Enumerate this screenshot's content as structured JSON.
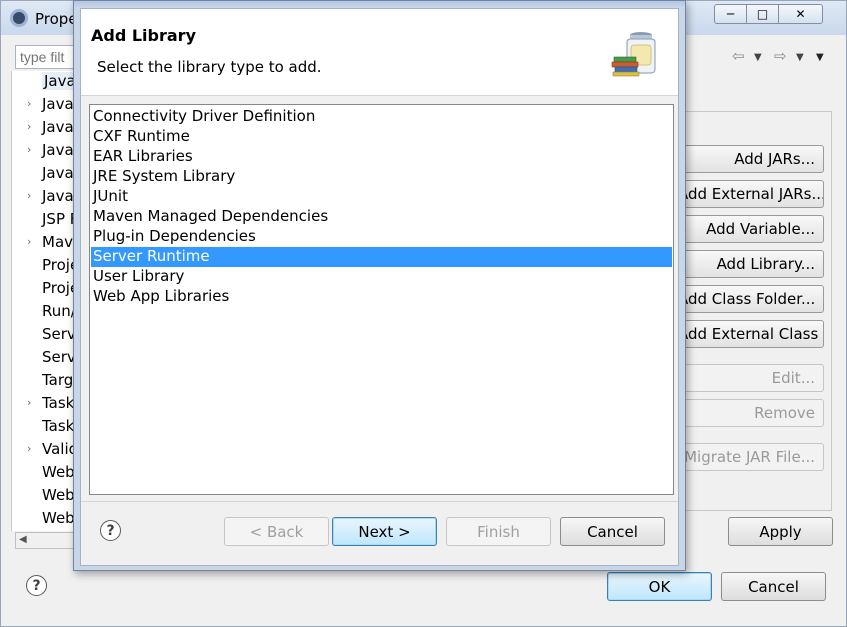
{
  "background_window": {
    "title": "Prope",
    "filter_placeholder": "type filt",
    "tree_items": [
      {
        "label": "Java",
        "chevron": false,
        "selected": true
      },
      {
        "label": "Java",
        "chevron": true
      },
      {
        "label": "Java",
        "chevron": true
      },
      {
        "label": "Java",
        "chevron": true
      },
      {
        "label": "Javad",
        "chevron": false
      },
      {
        "label": "JavaS",
        "chevron": true
      },
      {
        "label": "JSP F",
        "chevron": false
      },
      {
        "label": "Mave",
        "chevron": true
      },
      {
        "label": "Proje",
        "chevron": false
      },
      {
        "label": "Proje",
        "chevron": false
      },
      {
        "label": "Run/D",
        "chevron": false
      },
      {
        "label": "Serv",
        "chevron": false
      },
      {
        "label": "Serv",
        "chevron": false
      },
      {
        "label": "Targ",
        "chevron": false
      },
      {
        "label": "Task",
        "chevron": true
      },
      {
        "label": "Task",
        "chevron": false
      },
      {
        "label": "Valid",
        "chevron": true
      },
      {
        "label": "Web",
        "chevron": false
      },
      {
        "label": "Web",
        "chevron": false
      },
      {
        "label": "Web",
        "chevron": false
      }
    ],
    "side_buttons": [
      {
        "label": "Add JARs...",
        "enabled": true
      },
      {
        "label": "Add External JARs...",
        "enabled": true
      },
      {
        "label": "Add Variable...",
        "enabled": true
      },
      {
        "label": "Add Library...",
        "enabled": true
      },
      {
        "label": "Add Class Folder...",
        "enabled": true
      },
      {
        "label": "Add External Class Folder...",
        "enabled": true
      },
      {
        "label": "Edit...",
        "enabled": false
      },
      {
        "label": "Remove",
        "enabled": false
      },
      {
        "label": "Migrate JAR File...",
        "enabled": false
      }
    ],
    "apply_label": "Apply",
    "ok_label": "OK",
    "cancel_label": "Cancel",
    "help_glyph": "?"
  },
  "dialog": {
    "title": "Add Library",
    "subtitle": "Select the library type to add.",
    "library_types": [
      "Connectivity Driver Definition",
      "CXF Runtime",
      "EAR Libraries",
      "JRE System Library",
      "JUnit",
      "Maven Managed Dependencies",
      "Plug-in Dependencies",
      "Server Runtime",
      "User Library",
      "Web App Libraries"
    ],
    "selected_index": 7,
    "help_glyph": "?",
    "buttons": {
      "back": "< Back",
      "next": "Next >",
      "finish": "Finish",
      "cancel": "Cancel"
    }
  },
  "colors": {
    "selection": "#3399ff",
    "default_button_border": "#3c7fb1"
  }
}
